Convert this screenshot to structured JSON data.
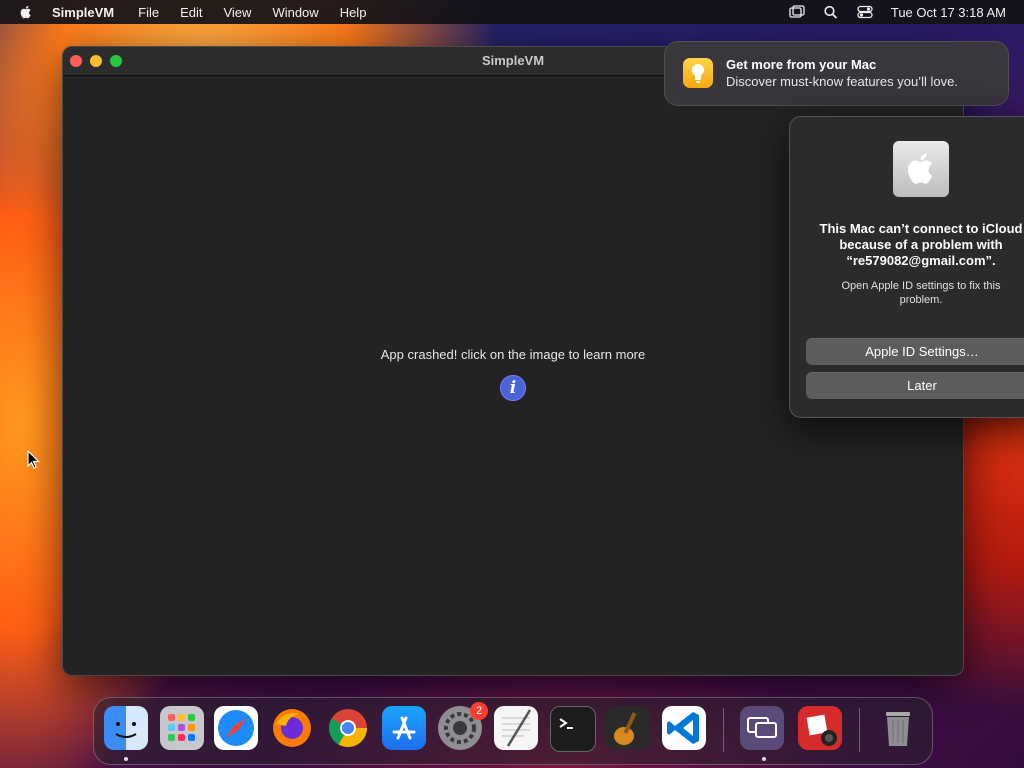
{
  "menubar": {
    "app_name": "SimpleVM",
    "menus": [
      "File",
      "Edit",
      "View",
      "Window",
      "Help"
    ],
    "clock": "Tue Oct 17  3:18 AM"
  },
  "window": {
    "title": "SimpleVM",
    "crash_message": "App crashed! click on the image to learn more",
    "info_glyph": "i"
  },
  "notification": {
    "title": "Get more from your Mac",
    "body": "Discover must-know features you’ll love."
  },
  "dialog": {
    "title": "This Mac can’t connect to iCloud because of a problem with “re579082@gmail.com”.",
    "body": "Open Apple ID settings to fix this problem.",
    "primary_button": "Apple ID Settings…",
    "secondary_button": "Later"
  },
  "dock": {
    "apps": [
      {
        "name": "Finder",
        "icon": "finder-icon",
        "running": true
      },
      {
        "name": "Launchpad",
        "icon": "launchpad-icon",
        "running": false
      },
      {
        "name": "Safari",
        "icon": "safari-icon",
        "running": false
      },
      {
        "name": "Firefox",
        "icon": "firefox-icon",
        "running": false
      },
      {
        "name": "Chrome",
        "icon": "chrome-icon",
        "running": false
      },
      {
        "name": "App Store",
        "icon": "app-store-icon",
        "running": false
      },
      {
        "name": "System Settings",
        "icon": "system-settings-icon",
        "running": false,
        "badge": "2"
      },
      {
        "name": "TextEdit",
        "icon": "textedit-icon",
        "running": false
      },
      {
        "name": "Terminal",
        "icon": "terminal-icon",
        "running": false
      },
      {
        "name": "GarageBand",
        "icon": "garageband-icon",
        "running": false
      },
      {
        "name": "Visual Studio Code",
        "icon": "vscode-icon",
        "running": false
      },
      {
        "name": "SimpleVM",
        "icon": "simplevm-icon",
        "running": true
      },
      {
        "name": "Photo Booth",
        "icon": "photo-booth-icon",
        "running": false
      },
      {
        "name": "Trash",
        "icon": "trash-icon",
        "running": false
      }
    ],
    "badge_settings": "2"
  },
  "colors": {
    "info_button": "#4a63d6",
    "notification_icon": "#f7b21b",
    "badge": "#ff3b30"
  }
}
